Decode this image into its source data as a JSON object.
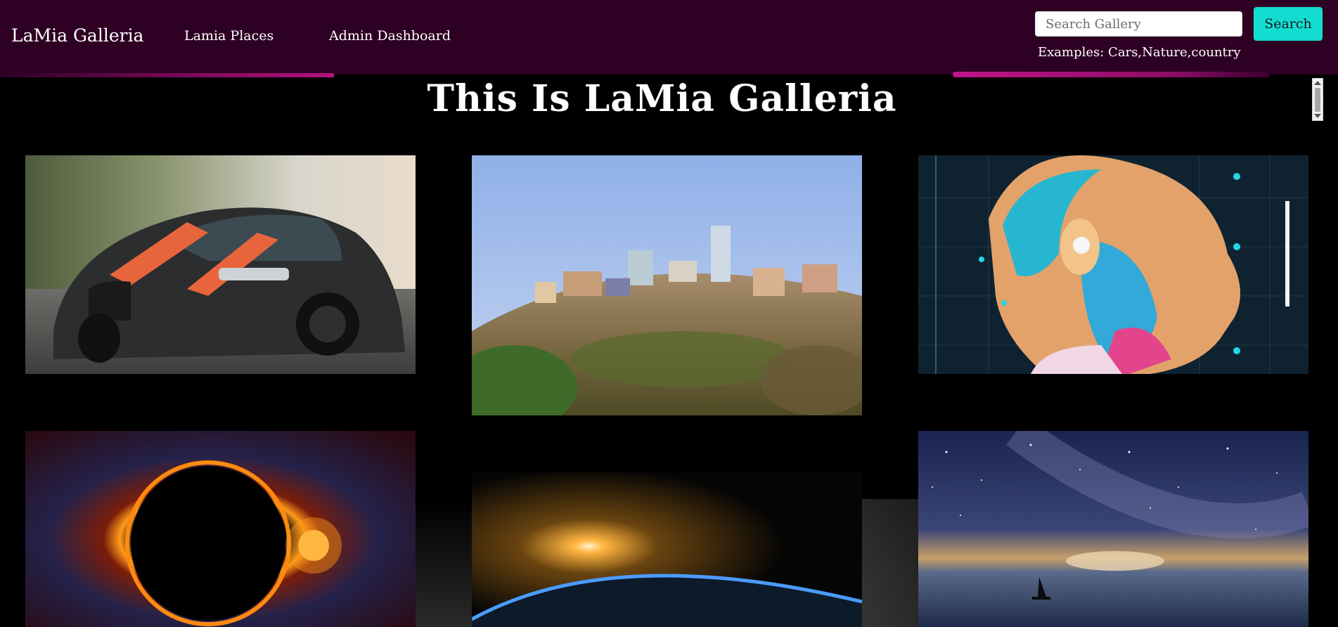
{
  "navbar": {
    "brand": "LaMia Galleria",
    "links": [
      {
        "label": "Lamia Places"
      },
      {
        "label": "Admin Dashboard"
      }
    ],
    "search": {
      "placeholder": "Search Gallery",
      "value": "",
      "button_label": "Search",
      "hint": "Examples: Cars,Nature,country"
    },
    "colors": {
      "background": "#2e0024",
      "accent": "#b4127e",
      "search_button": "#13ddd3"
    }
  },
  "main": {
    "title": "This Is LaMia Galleria"
  },
  "gallery": [
    {
      "subject": "sports-car"
    },
    {
      "subject": "city-skyline"
    },
    {
      "subject": "futuristic-portrait"
    },
    {
      "subject": "solar-eclipse"
    },
    {
      "subject": "earth-sunrise"
    },
    {
      "subject": "starry-sea-sailboat"
    }
  ]
}
